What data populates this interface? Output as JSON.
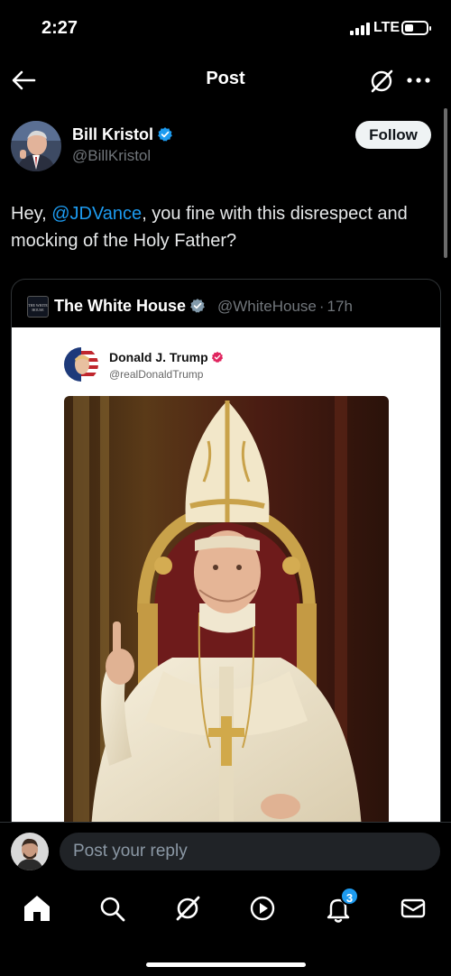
{
  "status_bar": {
    "time": "2:27",
    "network": "LTE"
  },
  "nav": {
    "title": "Post"
  },
  "post": {
    "author_name": "Bill Kristol",
    "author_handle": "@BillKristol",
    "follow_label": "Follow",
    "text_before": "Hey, ",
    "mention": "@JDVance",
    "text_after": ", you fine with this disrespect and mocking of the Holy Father?"
  },
  "quote": {
    "logo_text": "THE WHITE HOUSE",
    "name": "The White House",
    "handle": "@WhiteHouse",
    "separator": "·",
    "time": "17h",
    "embedded": {
      "name": "Donald J. Trump",
      "handle": "@realDonaldTrump"
    }
  },
  "reply": {
    "placeholder": "Post your reply"
  },
  "tabs": {
    "items": [
      "home",
      "search",
      "grok",
      "video",
      "notifications",
      "messages"
    ],
    "notification_count": "3"
  },
  "colors": {
    "background": "#000000",
    "accent": "#1d9bf0",
    "secondary_text": "#71767b",
    "follow_button": "#eff3f4"
  },
  "icons": [
    "back-arrow-icon",
    "grok-icon",
    "more-icon",
    "verified-icon",
    "home-icon",
    "search-icon",
    "grok-icon",
    "play-icon",
    "bell-icon",
    "mail-icon"
  ]
}
